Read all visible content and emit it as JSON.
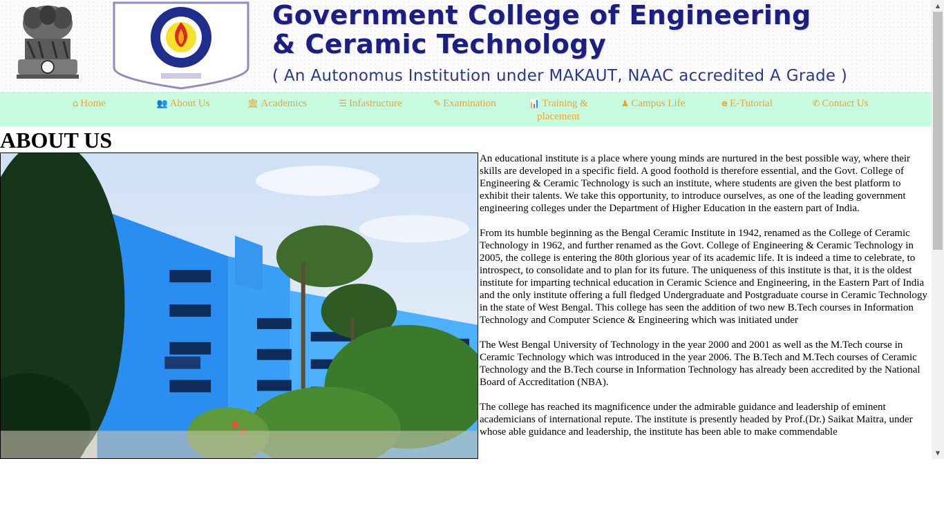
{
  "header": {
    "title_line1": "Government College of Engineering",
    "title_line2": "& Ceramic Technology",
    "subtitle": "( An Autonomus Institution under MAKAUT, NAAC accredited A Grade )"
  },
  "nav": {
    "items": [
      {
        "label": "Home",
        "icon": "home-icon"
      },
      {
        "label": "About Us",
        "icon": "users-icon"
      },
      {
        "label": "Academics",
        "icon": "institution-icon"
      },
      {
        "label": "Infastructure",
        "icon": "bars-icon"
      },
      {
        "label": "Examination",
        "icon": "edit-icon"
      },
      {
        "label": "Training &",
        "label2": "placement",
        "icon": "bar-chart-icon"
      },
      {
        "label": "Campus Life",
        "icon": "child-icon"
      },
      {
        "label": "E-Tutorial",
        "icon": "internet-explorer-icon"
      },
      {
        "label": "Contact Us",
        "icon": "phone-icon"
      }
    ],
    "text_color": "#f0a331",
    "background": "#c6fbe0"
  },
  "main": {
    "heading": "ABOUT US",
    "paragraphs": [
      "An educational institute is a place where young minds are nurtured in the best possible way, where their skills are developed in a specific field. A good foothold is therefore essential, and the Govt. College of Engineering & Ceramic Technology is such an institute, where students are given the best platform to exhibit their talents. We take this opportunity, to introduce ourselves, as one of the leading government engineering colleges under the Department of Higher Education in the eastern part of India.",
      "From its humble beginning as the Bengal Ceramic Institute in 1942, renamed as the College of Ceramic Technology in 1962, and further renamed as the Govt. College of Engineering & Ceramic Technology in 2005, the college is entering the 80th glorious year of its academic life. It is indeed a time to celebrate, to introspect, to consolidate and to plan for its future. The uniqueness of this institute is that, it is the oldest institute for imparting technical education in Ceramic Science and Engineering, in the Eastern Part of India and the only institute offering a full fledged Undergraduate and Postgraduate course in Ceramic Technology in the state of West Bengal. This college has seen the addition of two new B.Tech courses in Information Technology and Computer Science & Engineering which was initiated under",
      "The West Bengal University of Technology in the year 2000 and 2001 as well as the M.Tech course in Ceramic Technology which was introduced in the year 2006. The B.Tech and M.Tech courses of Ceramic Technology and the B.Tech course in Information Technology has already been accredited by the National Board of Accreditation (NBA).",
      "The college has reached its magnificence under the admirable guidance and leadership of eminent academicians of international repute. The institute is presently headed by Prof.(Dr.) Saikat Maitra, under whose able guidance and leadership, the institute has been able to make commendable"
    ]
  }
}
